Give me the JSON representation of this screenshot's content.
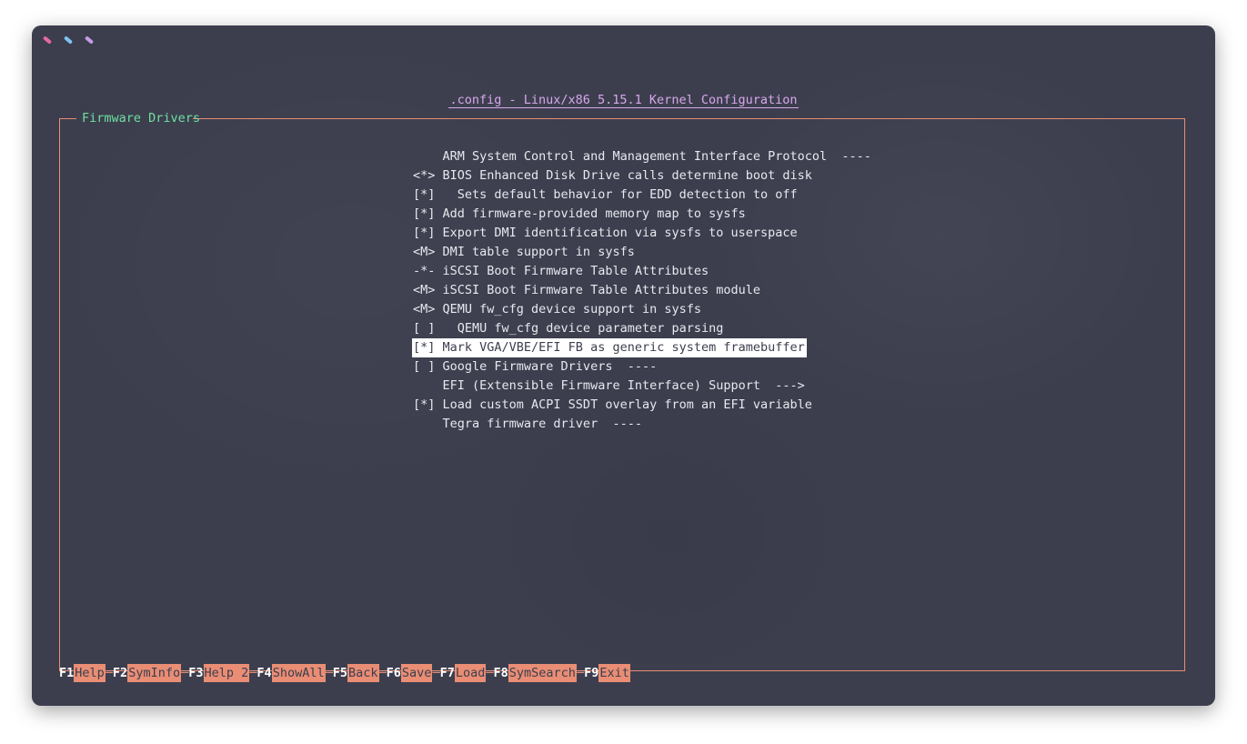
{
  "window": {
    "title": ".config - Linux/x86 5.15.1 Kernel Configuration",
    "dots": [
      {
        "name": "close-dot",
        "color": "#e66a9e"
      },
      {
        "name": "minimize-dot",
        "color": "#7ec3f0"
      },
      {
        "name": "maximize-dot",
        "color": "#c89be8"
      }
    ]
  },
  "panel": {
    "title": "Firmware Drivers"
  },
  "menu": {
    "selected_index": 10,
    "items": [
      "    ARM System Control and Management Interface Protocol  ----",
      "<*> BIOS Enhanced Disk Drive calls determine boot disk",
      "[*]   Sets default behavior for EDD detection to off",
      "[*] Add firmware-provided memory map to sysfs",
      "[*] Export DMI identification via sysfs to userspace",
      "<M> DMI table support in sysfs",
      "-*- iSCSI Boot Firmware Table Attributes",
      "<M> iSCSI Boot Firmware Table Attributes module",
      "<M> QEMU fw_cfg device support in sysfs",
      "[ ]   QEMU fw_cfg device parameter parsing",
      "[*] Mark VGA/VBE/EFI FB as generic system framebuffer",
      "[ ] Google Firmware Drivers  ----",
      "    EFI (Extensible Firmware Interface) Support  --->",
      "[*] Load custom ACPI SSDT overlay from an EFI variable",
      "    Tegra firmware driver  ----"
    ]
  },
  "function_keys": [
    {
      "key": "F1",
      "label": "Help"
    },
    {
      "key": "F2",
      "label": "SymInfo"
    },
    {
      "key": "F3",
      "label": "Help 2"
    },
    {
      "key": "F4",
      "label": "ShowAll"
    },
    {
      "key": "F5",
      "label": "Back"
    },
    {
      "key": "F6",
      "label": "Save"
    },
    {
      "key": "F7",
      "label": "Load"
    },
    {
      "key": "F8",
      "label": "SymSearch"
    },
    {
      "key": "F9",
      "label": "Exit"
    }
  ],
  "colors": {
    "background": "#3c3e4e",
    "accent": "#e98d74",
    "title": "#d8a8ec",
    "panel_title": "#6fe0a0",
    "text": "#e8e8ee"
  }
}
